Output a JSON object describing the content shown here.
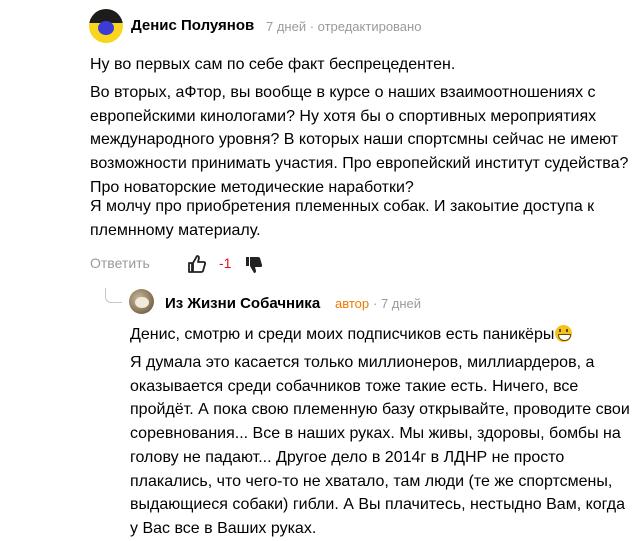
{
  "comment": {
    "author": "Денис Полуянов",
    "meta": "7 дней · отредактировано",
    "paragraphs": [
      "Ну во первых сам по себе факт беспрецедентен.",
      "Во вторых, аФтор, вы вообще в курсе о наших взаимоотношениях с европейскими кинологами? Ну хотя бы о спортивных мероприятиях международного уровня? В которых наши спортсмны сейчас не имеют возможности принимать участия. Про европейский институт судейства? Про новаторские методические наработки?",
      "Я молчу про приобретения племенных собак. И закоытие доступа к племнному материалу."
    ],
    "actions": {
      "reply_label": "Ответить",
      "score": "-1"
    },
    "icons": {
      "like": "thumbs-up-icon",
      "dislike": "thumbs-down-icon"
    }
  },
  "reply": {
    "author": "Из Жизни Собачника",
    "badge": "автор",
    "meta": "· 7 дней",
    "paragraphs": [
      "Денис, смотрю и среди моих подписчиков есть паникёры",
      "Я думала это касается только миллионеров, миллиардеров, а оказывается среди собачников тоже такие есть. Ничего, все пройдёт. А пока свою племенную базу открывайте, проводите свои соревнования... Все в наших руках. Мы живы, здоровы, бомбы на голову не падают... Другое дело в 2014г в ЛДНР не просто плакались, что чего-то не хватало, там люди (те же спортсмены, выдающиеся собаки) гибли. А Вы плачитесь, нестыдно Вам, когда у Вас все в Ваших руках."
    ],
    "icons": {
      "emoji": "grinning-emoji-icon"
    }
  },
  "colors": {
    "score": "#e0141e",
    "badge": "#f07800",
    "meta": "#9a9a9a"
  }
}
